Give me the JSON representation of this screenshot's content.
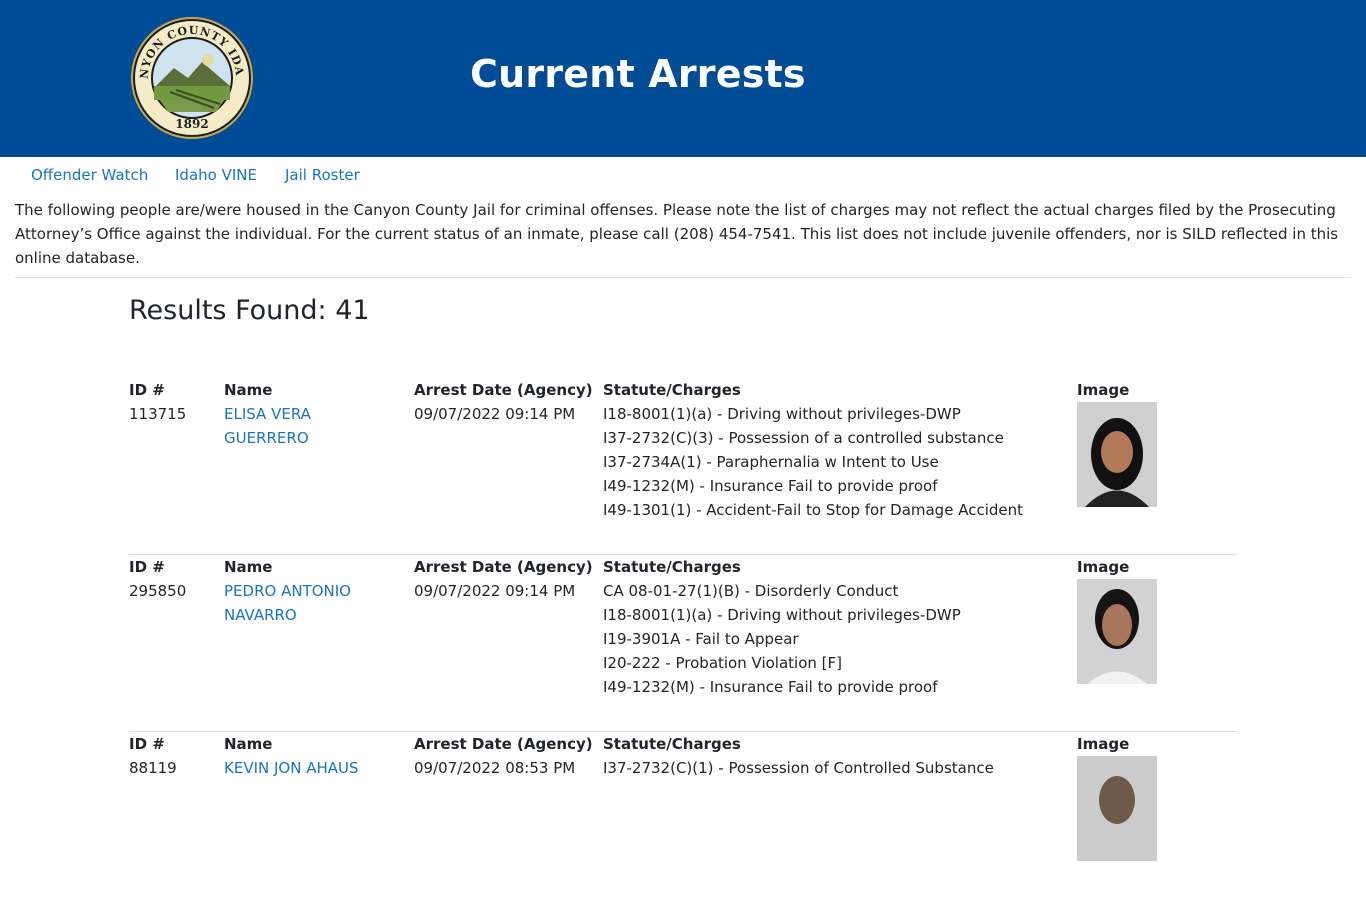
{
  "header": {
    "title": "Current Arrests",
    "seal_text": {
      "name": "CANYON COUNTY IDAHO",
      "year": "1892"
    },
    "background": "#004c97"
  },
  "nav": [
    {
      "label": "Offender Watch"
    },
    {
      "label": "Idaho VINE"
    },
    {
      "label": "Jail Roster"
    }
  ],
  "intro": "The following people are/were housed in the Canyon County Jail for criminal offenses. Please note the list of charges may not reflect the actual charges filed by the Prosecuting Attorney’s Office against the individual. For the current status of an inmate, please call (208) 454-7541. This list does not include juvenile offenders, nor is SILD reflected in this online database.",
  "results_label": "Results Found: 41",
  "columns": {
    "id": "ID #",
    "name": "Name",
    "date": "Arrest Date (Agency)",
    "charges": "Statute/Charges",
    "image": "Image"
  },
  "records": [
    {
      "id": "113715",
      "name_first": "ELISA VERA",
      "name_last": "GUERRERO",
      "date": "09/07/2022 09:14 PM",
      "charges": [
        "I18-8001(1)(a) - Driving without privileges-DWP",
        "I37-2732(C)(3) - Possession of a controlled substance",
        "I37-2734A(1) - Paraphernalia w Intent to Use",
        "I49-1232(M) - Insurance Fail to provide proof",
        "I49-1301(1) - Accident-Fail to Stop for Damage Accident"
      ]
    },
    {
      "id": "295850",
      "name_first": "PEDRO ANTONIO",
      "name_last": "NAVARRO",
      "date": "09/07/2022 09:14 PM",
      "charges": [
        "CA 08-01-27(1)(B) - Disorderly Conduct",
        "I18-8001(1)(a) - Driving without privileges-DWP",
        "I19-3901A - Fail to Appear",
        "I20-222 - Probation Violation [F]",
        "I49-1232(M) - Insurance Fail to provide proof"
      ]
    },
    {
      "id": "88119",
      "name_first": "KEVIN JON AHAUS",
      "name_last": "",
      "date": "09/07/2022 08:53 PM",
      "charges": [
        "I37-2732(C)(1) - Possession of Controlled Substance"
      ]
    }
  ]
}
